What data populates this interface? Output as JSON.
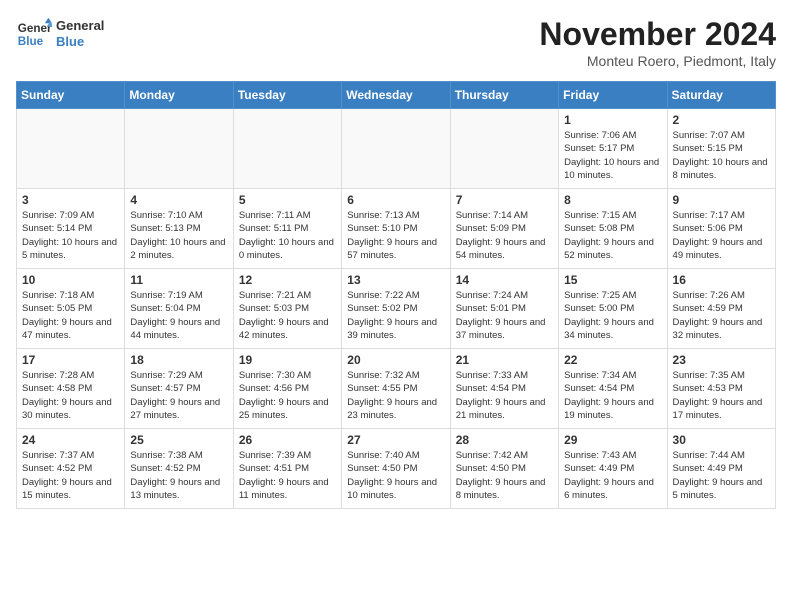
{
  "header": {
    "logo_line1": "General",
    "logo_line2": "Blue",
    "month_title": "November 2024",
    "location": "Monteu Roero, Piedmont, Italy"
  },
  "weekdays": [
    "Sunday",
    "Monday",
    "Tuesday",
    "Wednesday",
    "Thursday",
    "Friday",
    "Saturday"
  ],
  "weeks": [
    [
      {
        "day": "",
        "info": ""
      },
      {
        "day": "",
        "info": ""
      },
      {
        "day": "",
        "info": ""
      },
      {
        "day": "",
        "info": ""
      },
      {
        "day": "",
        "info": ""
      },
      {
        "day": "1",
        "info": "Sunrise: 7:06 AM\nSunset: 5:17 PM\nDaylight: 10 hours and 10 minutes."
      },
      {
        "day": "2",
        "info": "Sunrise: 7:07 AM\nSunset: 5:15 PM\nDaylight: 10 hours and 8 minutes."
      }
    ],
    [
      {
        "day": "3",
        "info": "Sunrise: 7:09 AM\nSunset: 5:14 PM\nDaylight: 10 hours and 5 minutes."
      },
      {
        "day": "4",
        "info": "Sunrise: 7:10 AM\nSunset: 5:13 PM\nDaylight: 10 hours and 2 minutes."
      },
      {
        "day": "5",
        "info": "Sunrise: 7:11 AM\nSunset: 5:11 PM\nDaylight: 10 hours and 0 minutes."
      },
      {
        "day": "6",
        "info": "Sunrise: 7:13 AM\nSunset: 5:10 PM\nDaylight: 9 hours and 57 minutes."
      },
      {
        "day": "7",
        "info": "Sunrise: 7:14 AM\nSunset: 5:09 PM\nDaylight: 9 hours and 54 minutes."
      },
      {
        "day": "8",
        "info": "Sunrise: 7:15 AM\nSunset: 5:08 PM\nDaylight: 9 hours and 52 minutes."
      },
      {
        "day": "9",
        "info": "Sunrise: 7:17 AM\nSunset: 5:06 PM\nDaylight: 9 hours and 49 minutes."
      }
    ],
    [
      {
        "day": "10",
        "info": "Sunrise: 7:18 AM\nSunset: 5:05 PM\nDaylight: 9 hours and 47 minutes."
      },
      {
        "day": "11",
        "info": "Sunrise: 7:19 AM\nSunset: 5:04 PM\nDaylight: 9 hours and 44 minutes."
      },
      {
        "day": "12",
        "info": "Sunrise: 7:21 AM\nSunset: 5:03 PM\nDaylight: 9 hours and 42 minutes."
      },
      {
        "day": "13",
        "info": "Sunrise: 7:22 AM\nSunset: 5:02 PM\nDaylight: 9 hours and 39 minutes."
      },
      {
        "day": "14",
        "info": "Sunrise: 7:24 AM\nSunset: 5:01 PM\nDaylight: 9 hours and 37 minutes."
      },
      {
        "day": "15",
        "info": "Sunrise: 7:25 AM\nSunset: 5:00 PM\nDaylight: 9 hours and 34 minutes."
      },
      {
        "day": "16",
        "info": "Sunrise: 7:26 AM\nSunset: 4:59 PM\nDaylight: 9 hours and 32 minutes."
      }
    ],
    [
      {
        "day": "17",
        "info": "Sunrise: 7:28 AM\nSunset: 4:58 PM\nDaylight: 9 hours and 30 minutes."
      },
      {
        "day": "18",
        "info": "Sunrise: 7:29 AM\nSunset: 4:57 PM\nDaylight: 9 hours and 27 minutes."
      },
      {
        "day": "19",
        "info": "Sunrise: 7:30 AM\nSunset: 4:56 PM\nDaylight: 9 hours and 25 minutes."
      },
      {
        "day": "20",
        "info": "Sunrise: 7:32 AM\nSunset: 4:55 PM\nDaylight: 9 hours and 23 minutes."
      },
      {
        "day": "21",
        "info": "Sunrise: 7:33 AM\nSunset: 4:54 PM\nDaylight: 9 hours and 21 minutes."
      },
      {
        "day": "22",
        "info": "Sunrise: 7:34 AM\nSunset: 4:54 PM\nDaylight: 9 hours and 19 minutes."
      },
      {
        "day": "23",
        "info": "Sunrise: 7:35 AM\nSunset: 4:53 PM\nDaylight: 9 hours and 17 minutes."
      }
    ],
    [
      {
        "day": "24",
        "info": "Sunrise: 7:37 AM\nSunset: 4:52 PM\nDaylight: 9 hours and 15 minutes."
      },
      {
        "day": "25",
        "info": "Sunrise: 7:38 AM\nSunset: 4:52 PM\nDaylight: 9 hours and 13 minutes."
      },
      {
        "day": "26",
        "info": "Sunrise: 7:39 AM\nSunset: 4:51 PM\nDaylight: 9 hours and 11 minutes."
      },
      {
        "day": "27",
        "info": "Sunrise: 7:40 AM\nSunset: 4:50 PM\nDaylight: 9 hours and 10 minutes."
      },
      {
        "day": "28",
        "info": "Sunrise: 7:42 AM\nSunset: 4:50 PM\nDaylight: 9 hours and 8 minutes."
      },
      {
        "day": "29",
        "info": "Sunrise: 7:43 AM\nSunset: 4:49 PM\nDaylight: 9 hours and 6 minutes."
      },
      {
        "day": "30",
        "info": "Sunrise: 7:44 AM\nSunset: 4:49 PM\nDaylight: 9 hours and 5 minutes."
      }
    ]
  ]
}
